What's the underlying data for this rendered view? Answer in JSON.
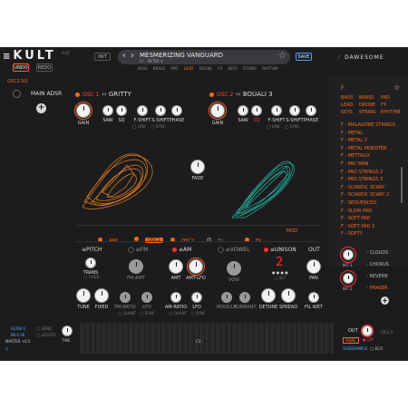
{
  "header": {
    "logo": "KULT",
    "version": "0.95",
    "undo": "UNDO",
    "redo": "REDO",
    "init": "INIT",
    "preset_name": "MESMERIZING VANGUARD",
    "by": "BY",
    "author": "PETER V.",
    "save": "SAVE",
    "brand": "DAWESOME",
    "categories": [
      "BASS",
      "BRASS",
      "PAD",
      "LEAD",
      "DRONE",
      "FX",
      "KEYS",
      "STRING",
      "RHYTHM"
    ],
    "active_category": "LEAD"
  },
  "left": {
    "osc_label": "OSC2 SQ",
    "main_adsr": "MAIN ADSR"
  },
  "osc1": {
    "label": "OSC 1",
    "shape": "GRITTY",
    "knobs": [
      "GAIN",
      "SAW",
      "SQ",
      "F-SHIFT",
      "S-SHIFT",
      "PHASE"
    ],
    "options": [
      "LINK",
      "SYNC"
    ]
  },
  "osc2": {
    "label": "OSC 2",
    "shape": "BOUALI 3",
    "knobs": [
      "GAIN",
      "SAW",
      "SQ",
      "F-SHIFT",
      "S-SHIFT",
      "PHASE"
    ],
    "options": [
      "LINK",
      "SYNC"
    ]
  },
  "fade_label": "FADE",
  "tabs": [
    "ARP",
    "OSC1",
    "OSC2",
    "FIL",
    "FX",
    "MOD"
  ],
  "active_tab": "OSC1",
  "sections": {
    "pitch": {
      "title": "PITCH",
      "trans": "TRANS",
      "fixed_switch": "FIXED",
      "knobs": [
        "TUNE",
        "FIXED"
      ]
    },
    "fm": {
      "title": "FM",
      "knobs": [
        "FM-AMT",
        "FM-RATIO",
        "LFO"
      ],
      "options": [
        "QUANT",
        "SYNC"
      ]
    },
    "am": {
      "title": "AM",
      "knobs": [
        "AMT",
        "AMT-LFO",
        "AM-RATIO",
        "LFO"
      ],
      "options": [
        "QUANT",
        "SYNC"
      ]
    },
    "vowel": {
      "title": "VOWEL",
      "knobs": [
        "VOW",
        "MODULA",
        "FORMANT"
      ]
    },
    "unison": {
      "title": "UNISON",
      "count": "2",
      "set": "SET",
      "knobs": [
        "DETUNE",
        "SPREAD"
      ]
    },
    "out": {
      "title": "OUT",
      "knobs": [
        "PAN",
        "FIL WET"
      ]
    }
  },
  "preset_list": {
    "filter_prefix": "F",
    "categories": [
      "BASS",
      "BRASS",
      "PAD",
      "LEAD",
      "DRONE",
      "FX",
      "KEYS",
      "STRING",
      "RHYTHM"
    ],
    "items": [
      "F - MALAGONE STRINGS",
      "F - METAL",
      "F - METAL 2",
      "F - METAL MONSTER",
      "F - METTALIX",
      "F - PAC MAN",
      "F - PAD STRINGS 2",
      "F - PAD STRINGS 3",
      "F - SCANDIC SCARY",
      "F - SCANDIC SCARY 2",
      "F - SEQUENCED",
      "F - SLOW PAD",
      "F - SOFT PAD",
      "F - SOFT PAD 2",
      "F - SOFTY"
    ]
  },
  "fx": {
    "knobs": [
      "INT 1",
      "INT 2"
    ],
    "items": [
      "CLOUDS",
      "CHORUS",
      "REVERB",
      "PHASER"
    ],
    "active": "PHASER"
  },
  "bottom_left": {
    "glide": "GLIDE 0",
    "pb": "PB 0.36",
    "master": "MASTER",
    "master_val": "+0.5",
    "bend": "BEND",
    "legato": "LEGATO",
    "time": "TIME"
  },
  "keyboard": {
    "marker": "C3"
  },
  "output": {
    "out": "OUT",
    "panic": "PANIC",
    "lim": "LIM",
    "cell_s": "CELL S",
    "oversample": "OVERSAMPLE",
    "eco": "ECO"
  },
  "colors": {
    "accent": "#ff6a1a",
    "osc1_trace": "#ff8a1f",
    "osc2_trace": "#26c9b0",
    "red": "#ff3030"
  }
}
